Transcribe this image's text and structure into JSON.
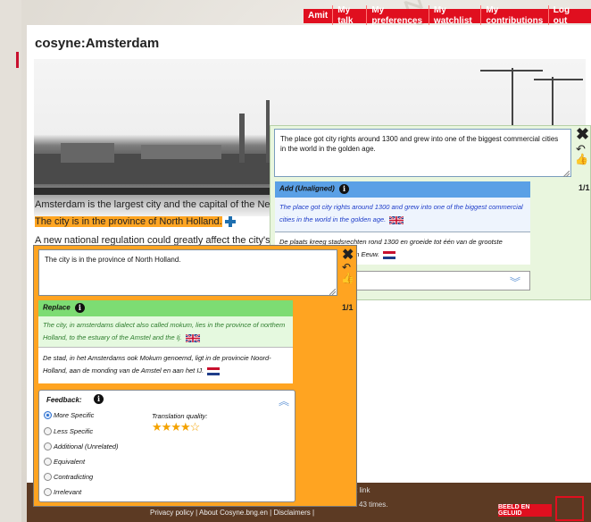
{
  "usermenu": {
    "items": [
      "Amit",
      "My talk",
      "My preferences",
      "My watchlist",
      "My contributions",
      "Log out"
    ]
  },
  "page": {
    "title": "cosyne:Amsterdam"
  },
  "article": {
    "line1": "Amsterdam is the largest city and the capital of the Netherla",
    "line2": "The city is in the province of North Holland.",
    "line3": "A new national regulation could greatly affect the city's fame"
  },
  "panel1": {
    "textarea_value": "The place got city rights around 1300 and grew into one of the biggest commercial cities in the world in the golden age.",
    "count": "1/1",
    "header_label": "Add (Unaligned)",
    "source_text": "The place got city rights around 1300 and grew into one of the biggest commercial cities in the world in the golden age.",
    "target_text": "De plaats kreeg stadsrechten rond 1300 en groeide tot één van de grootste",
    "target_text_tail": "n de Gouden Eeuw."
  },
  "panel2": {
    "textarea_value": "The city is in the province of North Holland.",
    "count": "1/1",
    "header_label": "Replace",
    "source_text": "The city, in amsterdams dialect also called mokum, lies in the province of northem Holland, to the estuary of the Amstel and the Ij.",
    "target_text": "De stad, in het Amsterdams ook Mokum genoemd, ligt in de provincie Noord-Holland, aan de monding van de Amstel en aan het IJ."
  },
  "feedback": {
    "title": "Feedback:",
    "options": [
      "More Specific",
      "Less Specific",
      "Additional (Unrelated)",
      "Equivalent",
      "Contradicting",
      "Irrelevant"
    ],
    "selected": "More Specific",
    "translation_quality_label": "Translation quality:",
    "rating": 4,
    "rating_max": 5
  },
  "footer": {
    "partial_text_1": "t link",
    "partial_text_2": "l 43 times.",
    "links": "Privacy policy  |  About Cosyne.bng.en  |  Disclaimers  |",
    "brand": "BEELD EN GELUID"
  },
  "colors": {
    "accent_red": "#e00f1f",
    "highlight_orange": "#ffa521",
    "add_header_blue": "#5aa0e6",
    "replace_header_green": "#7ddc73"
  },
  "icons": {
    "close": "close-icon",
    "undo": "undo-icon",
    "thumbs_up": "thumbs-up-icon",
    "info": "info-icon",
    "collapse": "chevron-double-icon",
    "add": "plus-icon",
    "flag_uk": "uk-flag-icon",
    "flag_nl": "nl-flag-icon"
  }
}
